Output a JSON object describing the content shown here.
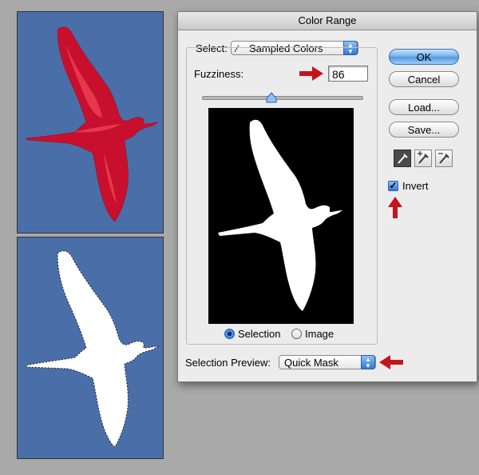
{
  "dialog": {
    "title": "Color Range",
    "select_label": "Select:",
    "select_value": "Sampled Colors",
    "fuzziness_label": "Fuzziness:",
    "fuzziness_value": "86",
    "fuzziness_level": 0.43,
    "radio_selection": "Selection",
    "radio_image": "Image",
    "selected_radio": "Selection",
    "selection_preview_label": "Selection Preview:",
    "selection_preview_value": "Quick Mask",
    "invert_label": "Invert",
    "invert_checked": true
  },
  "buttons": {
    "ok": "OK",
    "cancel": "Cancel",
    "load": "Load...",
    "save": "Save..."
  },
  "icons": [
    "eyedropper-icon",
    "eyedropper-plus-icon",
    "eyedropper-minus-icon",
    "red-arrow-icon"
  ],
  "colors": {
    "sky_blue": "#4a6ea8",
    "mask_red": "#c8102e",
    "annotation_red": "#c4151c",
    "accent_blue": "#2f7ad8"
  }
}
